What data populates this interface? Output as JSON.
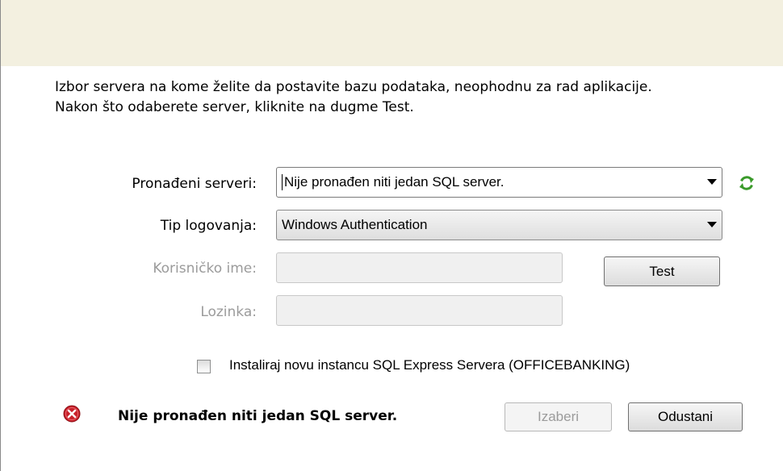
{
  "intro": {
    "line1": "Izbor servera na kome želite da postavite bazu podataka, neophodnu za rad aplikacije.",
    "line2": "Nakon što odaberete server, kliknite na dugme Test."
  },
  "form": {
    "servers_label": "Pronađeni serveri:",
    "servers_value": "Nije pronađen niti jedan SQL server.",
    "login_type_label": "Tip logovanja:",
    "login_type_value": "Windows Authentication",
    "username_label": "Korisničko ime:",
    "password_label": "Lozinka:",
    "test_button": "Test",
    "install_checkbox_label": "Instaliraj novu instancu SQL Express Servera (OFFICEBANKING)",
    "install_checked": false
  },
  "footer": {
    "status_text": "Nije pronađen niti jedan SQL server.",
    "select_button": "Izaberi",
    "cancel_button": "Odustani"
  },
  "icons": {
    "refresh": "refresh-icon",
    "error": "error-icon"
  },
  "colors": {
    "header_band": "#f3f0e0",
    "refresh_green": "#3a9a2a",
    "error_red": "#c8202a",
    "disabled_text": "#9b9b9b"
  }
}
